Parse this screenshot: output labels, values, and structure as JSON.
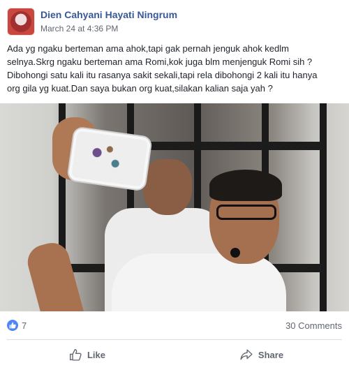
{
  "post": {
    "author": "Dien Cahyani Hayati Ningrum",
    "timestamp": "March 24 at 4:36 PM",
    "text": "Ada yg ngaku berteman ama ahok,tapi gak pernah jenguk ahok kedlm\nselnya.Skrg ngaku berteman ama Romi,kok juga blm menjenguk Romi sih ?\nDibohongi satu kali itu rasanya sakit sekali,tapi rela dibohongi 2 kali itu hanya\norg gila yg kuat.Dan saya bukan org kuat,silakan kalian saja yah ?"
  },
  "stats": {
    "like_count": "7",
    "comments": "30 Comments"
  },
  "actions": {
    "like_label": "Like",
    "share_label": "Share"
  },
  "icons": {
    "like_reaction": "thumbs-up-icon",
    "like_button": "thumbs-up-outline-icon",
    "share_button": "share-arrow-icon"
  },
  "colors": {
    "author_link": "#385898",
    "like_badge": "#4f86f7",
    "muted_text": "#616770"
  }
}
